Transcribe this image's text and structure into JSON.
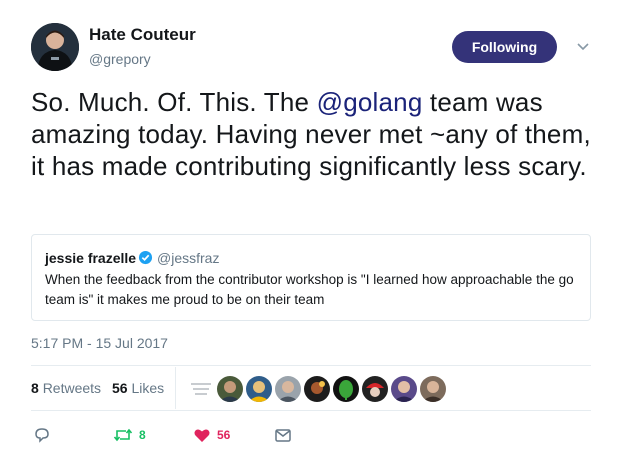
{
  "author": {
    "name": "Hate Couteur",
    "handle": "@grepory"
  },
  "follow_button": {
    "label": "Following",
    "color": "#343379"
  },
  "tweet": {
    "text_before": "So. Much. Of. This. The ",
    "mention": "@golang",
    "text_after": " team was amazing today. Having never met ~any of them, it has made contributing significantly less scary."
  },
  "quoted_tweet": {
    "name": "jessie frazelle",
    "handle": "@jessfraz",
    "text": "When the feedback from the contributor workshop is \"I learned how approachable the go team is\" it makes me proud to be on their team"
  },
  "timestamp": "5:17 PM - 15 Jul 2017",
  "stats": {
    "retweets_count": "8",
    "retweets_label": "Retweets",
    "likes_count": "56",
    "likes_label": "Likes"
  },
  "actions": {
    "reply_icon": "reply-icon",
    "retweet_icon": "retweet-icon",
    "retweet_count": "8",
    "like_icon": "heart-icon",
    "like_count": "56",
    "dm_icon": "envelope-icon"
  },
  "colors": {
    "retweet": "#17bf63",
    "like": "#e0245e",
    "secondary": "#657786",
    "mention": "#1b2379"
  }
}
